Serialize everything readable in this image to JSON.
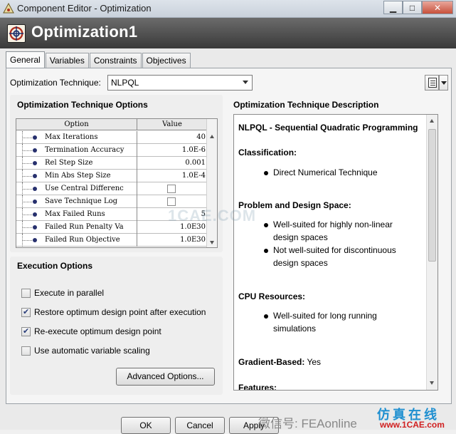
{
  "window": {
    "title": "Component Editor - Optimization",
    "minimize": "▁",
    "maximize": "□",
    "close": "✕"
  },
  "header": {
    "title": "Optimization1"
  },
  "tabs": [
    {
      "label": "General",
      "active": true
    },
    {
      "label": "Variables"
    },
    {
      "label": "Constraints"
    },
    {
      "label": "Objectives"
    }
  ],
  "technique": {
    "label": "Optimization Technique:",
    "value": "NLPQL"
  },
  "options_group": {
    "title": "Optimization Technique Options",
    "columns": [
      "Option",
      "Value"
    ],
    "rows": [
      {
        "name": "Max Iterations",
        "value": "40"
      },
      {
        "name": "Termination Accuracy",
        "value": "1.0E-6"
      },
      {
        "name": "Rel Step Size",
        "value": "0.001"
      },
      {
        "name": "Min Abs Step Size",
        "value": "1.0E-4"
      },
      {
        "name": "Use Central Differenc",
        "checkbox": true,
        "checked": false
      },
      {
        "name": "Save Technique Log",
        "checkbox": true,
        "checked": false
      },
      {
        "name": "Max Failed Runs",
        "value": "5"
      },
      {
        "name": "Failed Run Penalty Va",
        "value": "1.0E30"
      },
      {
        "name": "Failed Run Objective ",
        "value": "1.0E30"
      }
    ]
  },
  "execution": {
    "title": "Execution Options",
    "options": [
      {
        "label": "Execute in parallel",
        "checked": false
      },
      {
        "label": "Restore optimum design point after execution",
        "checked": true
      },
      {
        "label": "Re-execute optimum design point",
        "checked": true
      },
      {
        "label": "Use automatic variable scaling",
        "checked": false
      }
    ],
    "advanced_label": "Advanced Options..."
  },
  "description": {
    "title": "Optimization Technique Description",
    "heading": "NLPQL - Sequential Quadratic Programming",
    "classification_label": "Classification:",
    "classification_items": [
      "Direct Numerical Technique"
    ],
    "problem_label": "Problem and Design Space:",
    "problem_items": [
      "Well-suited for highly non-linear design spaces",
      "Not well-suited for discontinuous design spaces"
    ],
    "cpu_label": "CPU Resources:",
    "cpu_items": [
      "Well-suited for long running simulations"
    ],
    "gradient_label": "Gradient-Based:",
    "gradient_value": " Yes",
    "features_label": "Features:"
  },
  "buttons": {
    "ok": "OK",
    "cancel": "Cancel",
    "apply": "Apply"
  },
  "watermark": {
    "center": "1CAE.COM",
    "wechat": "微信号: FEAonline",
    "cn": "仿真在线",
    "site": "www.1CAE.com"
  }
}
